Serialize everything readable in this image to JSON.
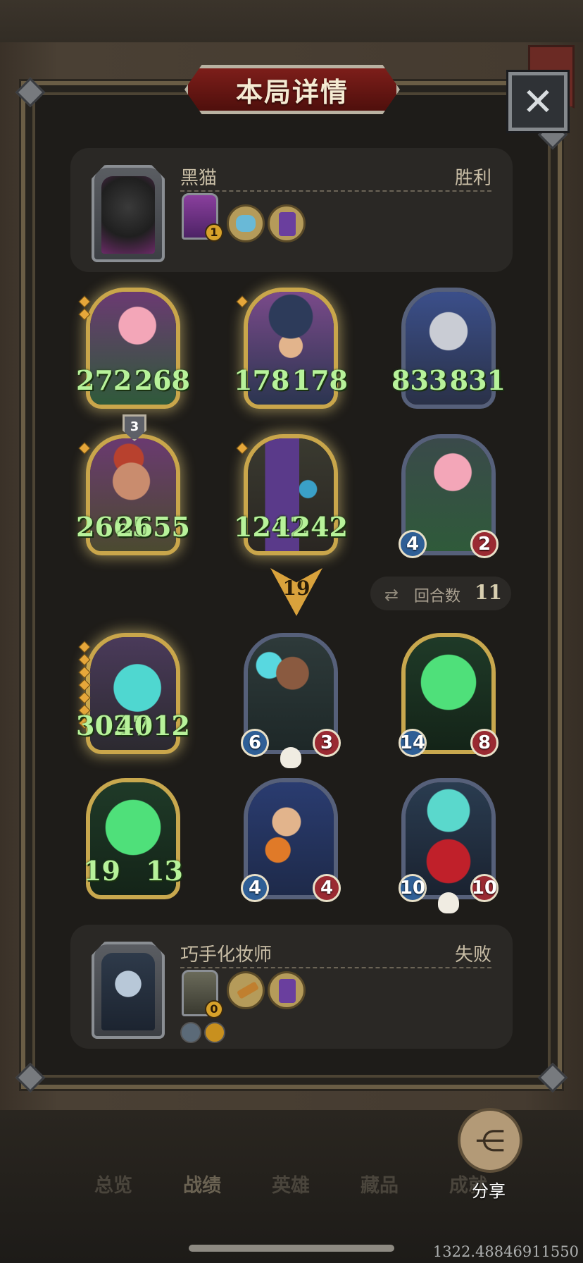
{
  "dialog": {
    "title": "本局详情",
    "close_icon": "close-icon"
  },
  "winner": {
    "name": "黑猫",
    "result": "胜利",
    "hero_level": "1",
    "items": [
      "goldfish-bowl-icon",
      "purple-tome-icon"
    ]
  },
  "winner_board": [
    {
      "atk": "272",
      "hp": "268",
      "golden": true,
      "pips": 2
    },
    {
      "atk": "178",
      "hp": "178",
      "golden": true,
      "pips": 1
    },
    {
      "atk": "833",
      "hp": "831",
      "golden": false,
      "pips": 0
    },
    {
      "atk": "2665",
      "hp": "2655",
      "golden": true,
      "pips": 1,
      "badge": "3"
    },
    {
      "atk": "1242",
      "hp": "1242",
      "golden": false,
      "pips": 1
    },
    {
      "atk": "4",
      "hp": "2",
      "golden": false,
      "pips": 0
    }
  ],
  "turn": {
    "number": "19",
    "round_label": "回合数",
    "round_count": "11"
  },
  "loser_board": [
    {
      "atk": "3027",
      "hp": "4012",
      "golden": true,
      "pips": 7
    },
    {
      "atk": "6",
      "hp": "3",
      "golden": false,
      "skull": true
    },
    {
      "atk": "14",
      "hp": "8",
      "golden": false
    },
    {
      "atk": "19",
      "hp": "13",
      "golden": false
    },
    {
      "atk": "4",
      "hp": "4",
      "golden": false
    },
    {
      "atk": "10",
      "hp": "10",
      "golden": false,
      "skull": true
    }
  ],
  "loser": {
    "name": "巧手化妆师",
    "result": "失败",
    "hero_level": "0",
    "items": [
      "hammer-icon",
      "purple-tome-icon"
    ],
    "extras": [
      "crossed-swords-icon",
      "gold-horn-icon"
    ]
  },
  "nav": {
    "items": [
      "总览",
      "战绩",
      "英雄",
      "藏品",
      "成就"
    ],
    "active": "战绩"
  },
  "share": {
    "label": "分享",
    "icon": "share-icon"
  },
  "coords": "1322.48846911550"
}
